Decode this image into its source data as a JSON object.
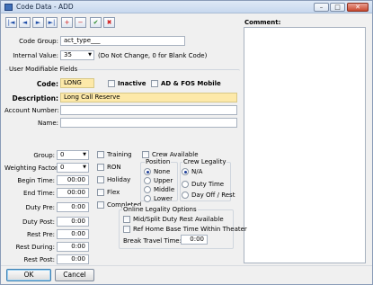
{
  "window": {
    "title": "Code Data - ADD"
  },
  "titlebar_buttons": {
    "minimize": "–",
    "maximize": "□",
    "close": "✕"
  },
  "toolbar": [
    {
      "name": "first-record-button",
      "glyph": "|◄"
    },
    {
      "name": "previous-record-button",
      "glyph": "◄"
    },
    {
      "name": "next-record-button",
      "glyph": "►"
    },
    {
      "name": "last-record-button",
      "glyph": "►|"
    },
    {
      "name": "add-record-button",
      "glyph": "+"
    },
    {
      "name": "delete-record-button",
      "glyph": "−"
    },
    {
      "name": "save-record-button",
      "glyph": "✔"
    },
    {
      "name": "cancel-record-button",
      "glyph": "✖"
    }
  ],
  "top": {
    "code_group_label": "Code Group:",
    "code_group_value": "act_type___",
    "internal_value_label": "Internal Value:",
    "internal_value_value": "35",
    "internal_value_hint": "(Do Not Change, 0 for Blank Code)"
  },
  "user_fields": {
    "legend": "User Modifiable Fields",
    "code_label": "Code:",
    "code_value": "LONG",
    "inactive_label": "Inactive",
    "ad_fos_label": "AD & FOS Mobile",
    "description_label": "Description:",
    "description_value": "Long Call Reserve",
    "account_number_label": "Account Number:",
    "account_number_value": "",
    "name_label": "Name:",
    "name_value": ""
  },
  "left_col": {
    "group_label": "Group:",
    "group_value": "0",
    "weighting_label": "Weighting Factor:",
    "weighting_value": "0",
    "begin_time_label": "Begin Time:",
    "begin_time_value": "00:00",
    "end_time_label": "End Time:",
    "end_time_value": "00:00",
    "duty_pre_label": "Duty Pre:",
    "duty_pre_value": "0:00",
    "duty_post_label": "Duty Post:",
    "duty_post_value": "0:00",
    "rest_pre_label": "Rest Pre:",
    "rest_pre_value": "0:00",
    "rest_during_label": "Rest During:",
    "rest_during_value": "0:00",
    "rest_post_label": "Rest Post:",
    "rest_post_value": "0:00"
  },
  "flags": {
    "training": "Training",
    "ron": "RON",
    "holiday": "Holiday",
    "flex": "Flex",
    "completed": "Completed",
    "crew_available": "Crew Available"
  },
  "position": {
    "legend": "Position",
    "options": [
      "None",
      "Upper",
      "Middle",
      "Lower"
    ],
    "selected": "None"
  },
  "crew_legality": {
    "legend": "Crew Legality",
    "options": [
      "N/A",
      "Duty Time",
      "Day Off / Rest"
    ],
    "selected": "N/A"
  },
  "online_legality": {
    "legend": "Online Legality Options",
    "mid_split_label": "Mid/Split Duty Rest Available",
    "ref_home_label": "Ref Home Base Time Within Theater",
    "break_travel_label": "Break Travel Time:",
    "break_travel_value": "0:00"
  },
  "comment": {
    "label": "Comment:"
  },
  "footer": {
    "ok_label": "OK",
    "cancel_label": "Cancel"
  }
}
